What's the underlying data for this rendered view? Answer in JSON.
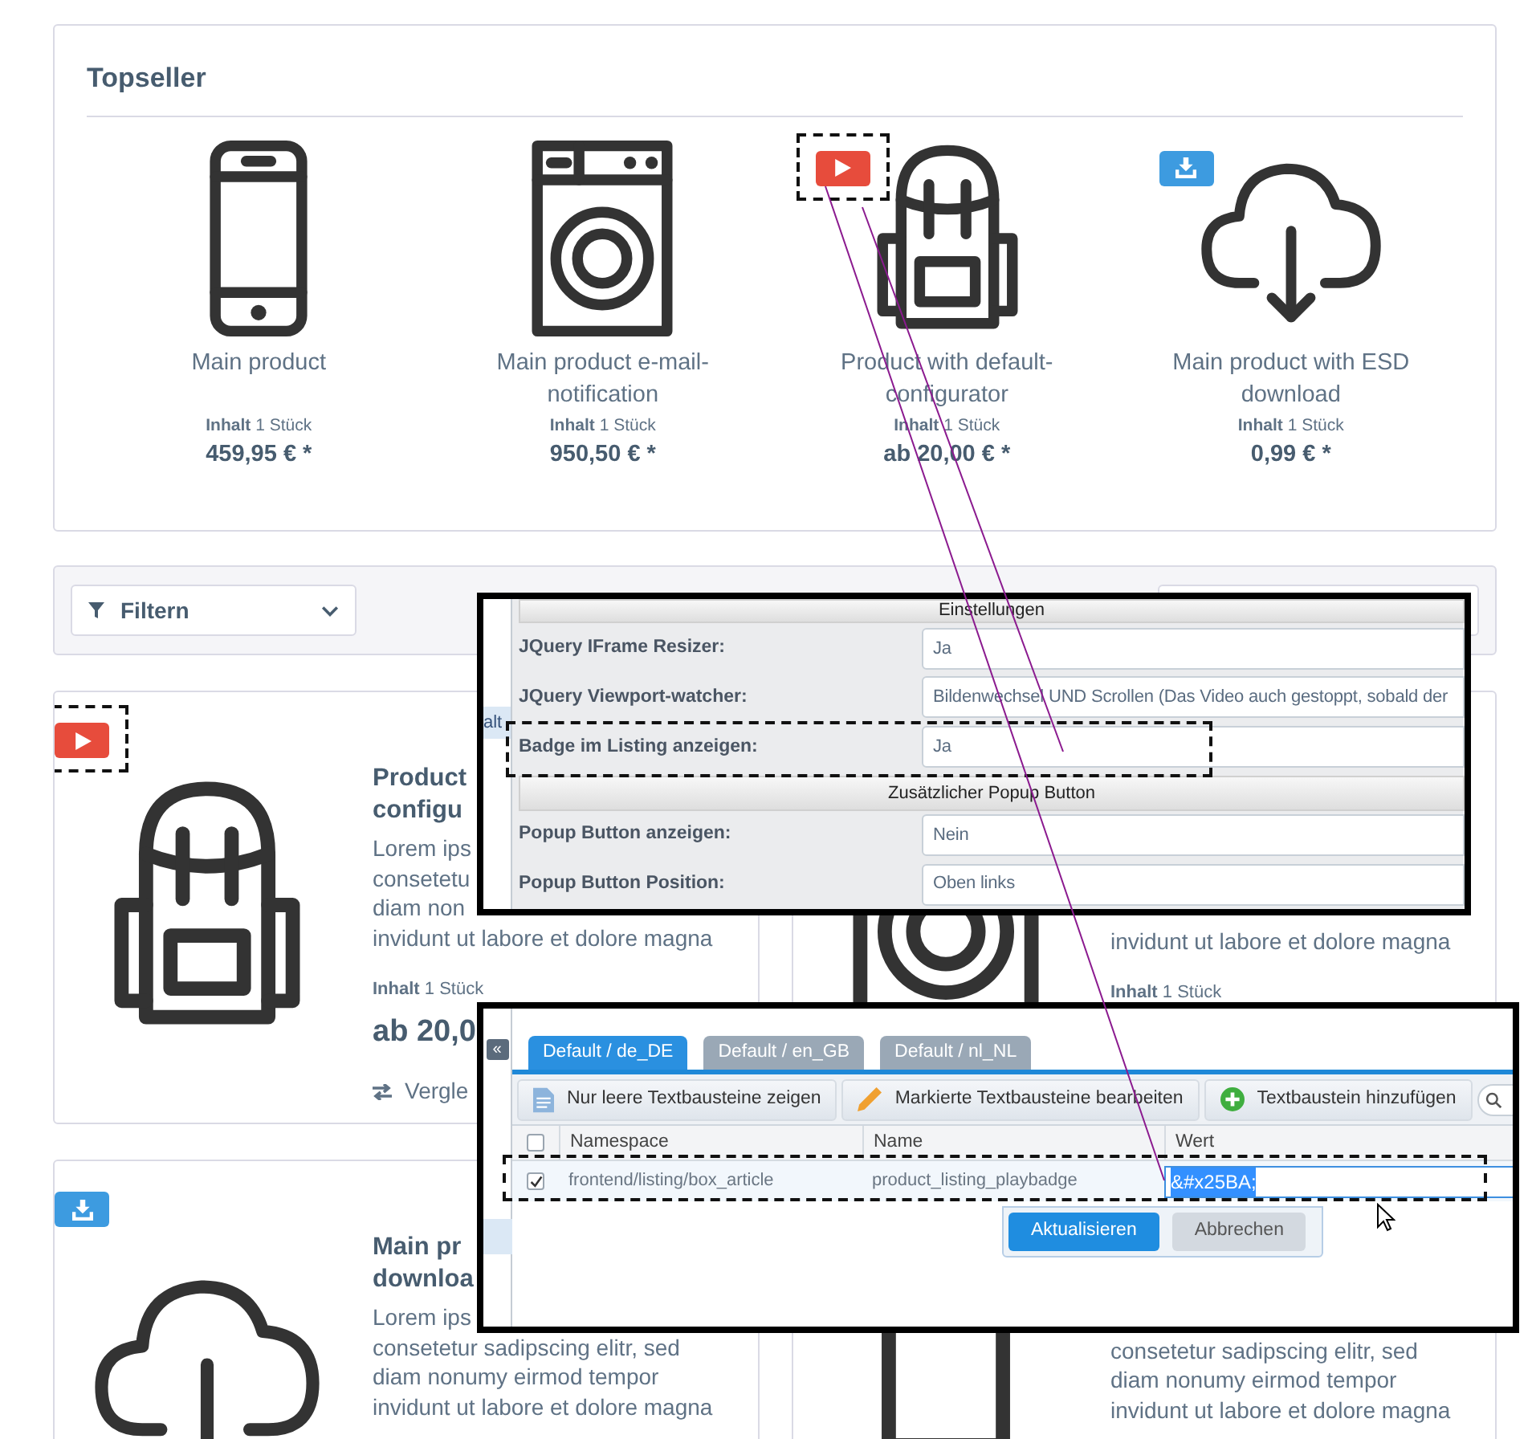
{
  "topseller": {
    "title": "Topseller",
    "products": [
      {
        "kind": "phone",
        "name": "Main product",
        "unit_label": "Inhalt",
        "unit": "1 Stück",
        "price": "459,95 € *"
      },
      {
        "kind": "washer",
        "name": "Main product e-mail-notification",
        "unit_label": "Inhalt",
        "unit": "1 Stück",
        "price": "950,50 € *"
      },
      {
        "kind": "backpack",
        "badge": {
          "kind": "video",
          "highlighted": true
        },
        "name": "Product with default-configurator",
        "unit_label": "Inhalt",
        "unit": "1 Stück",
        "price": "ab 20,00 € *"
      },
      {
        "kind": "cloud",
        "badge": {
          "kind": "download"
        },
        "name": "Main product with ESD download",
        "unit_label": "Inhalt",
        "unit": "1 Stück",
        "price": "0,99 € *"
      }
    ]
  },
  "filter": {
    "label": "Filtern"
  },
  "listing": [
    {
      "kind": "backpack",
      "badge": {
        "kind": "video",
        "highlighted": true
      },
      "title_lines": [
        "Product",
        "configu"
      ],
      "description_lines": [
        "Lorem ips",
        "consetetu",
        "diam non",
        "invidunt ut labore et dolore magna"
      ],
      "unit_label": "Inhalt",
      "unit": "1 Stück",
      "price": "ab 20,0",
      "compare": "Vergle"
    },
    {
      "kind": "washer",
      "description_lines": [
        "invidunt ut labore et dolore magna"
      ],
      "unit_label": "Inhalt",
      "unit": "1 Stück"
    },
    {
      "kind": "cloud",
      "badge": {
        "kind": "download"
      },
      "title_lines": [
        "Main pr",
        "downloa"
      ],
      "description_lines": [
        "Lorem ips",
        "consetetur sadipscing elitr, sed",
        "diam nonumy eirmod tempor",
        "invidunt ut labore et dolore magna"
      ]
    },
    {
      "kind": "phone",
      "description_lines": [
        "consetetur sadipscing elitr, sed",
        "diam nonumy eirmod tempor",
        "invidunt ut labore et dolore magna"
      ]
    }
  ],
  "settings_window": {
    "sidebar_fragment": "alt",
    "items": [
      {
        "kind": "section",
        "label": "Einstellungen"
      },
      {
        "kind": "field",
        "label": "JQuery IFrame Resizer:",
        "value": "Ja"
      },
      {
        "kind": "field",
        "label": "JQuery Viewport-watcher:",
        "value": "Bildenwechsel UND Scrollen (Das Video auch gestoppt, sobald der"
      },
      {
        "kind": "field",
        "label": "Badge im Listing anzeigen:",
        "value": "Ja",
        "highlighted": true
      },
      {
        "kind": "section",
        "label": "Zusätzlicher Popup Button"
      },
      {
        "kind": "field",
        "label": "Popup Button anzeigen:",
        "value": "Nein"
      },
      {
        "kind": "field",
        "label": "Popup Button Position:",
        "value": "Oben links"
      }
    ]
  },
  "translation_window": {
    "collapse": "«",
    "tabs": [
      {
        "label": "Default / de_DE",
        "selected": true
      },
      {
        "label": "Default / en_GB",
        "selected": false
      },
      {
        "label": "Default / nl_NL",
        "selected": false
      }
    ],
    "toolbar": [
      {
        "kind": "document",
        "label": "Nur leere Textbausteine zeigen"
      },
      {
        "kind": "pencil",
        "label": "Markierte Textbausteine bearbeiten"
      },
      {
        "kind": "add",
        "label": "Textbaustein hinzufügen"
      }
    ],
    "all_checked": false,
    "columns": [
      "Namespace",
      "Name",
      "Wert"
    ],
    "rows": [
      {
        "checked": true,
        "highlighted": true,
        "namespace": "frontend/listing/box_article",
        "name": "product_listing_playbadge",
        "value": "&#x25BA;",
        "text_selected": true
      }
    ],
    "actions": [
      {
        "kind": "primary",
        "label": "Aktualisieren"
      },
      {
        "kind": "secondary",
        "label": "Abbrechen"
      }
    ]
  }
}
